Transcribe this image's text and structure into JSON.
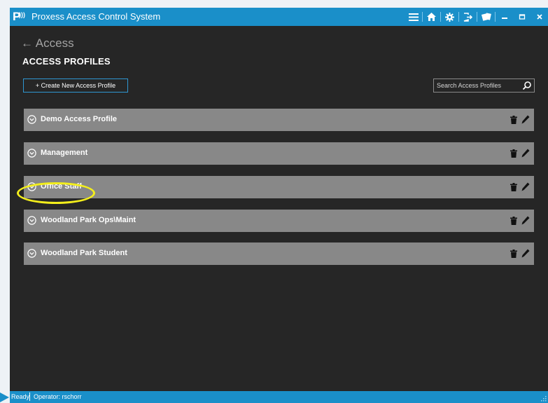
{
  "window": {
    "title": "Proxess Access Control System"
  },
  "titlebar": {
    "icons": [
      "menu-icon",
      "home-icon",
      "settings-icon",
      "logout-icon",
      "cards-icon",
      "minimize-icon",
      "maximize-icon",
      "close-icon"
    ]
  },
  "nav": {
    "back_label": "Access"
  },
  "page": {
    "title": "ACCESS PROFILES"
  },
  "toolbar": {
    "create_label": "+ Create New Access Profile"
  },
  "search": {
    "placeholder": "Search Access Profiles",
    "value": ""
  },
  "profiles": [
    {
      "name": "Demo Access Profile"
    },
    {
      "name": "Management"
    },
    {
      "name": "Office Staff",
      "highlighted": true
    },
    {
      "name": "Woodland Park Ops\\Maint"
    },
    {
      "name": "Woodland Park Student"
    }
  ],
  "status": {
    "ready": "Ready",
    "operator": "Operator:  rschorr"
  },
  "colors": {
    "accent": "#1a8fc9",
    "background": "#262626",
    "row": "#888888",
    "highlight": "#f3ee1c"
  }
}
